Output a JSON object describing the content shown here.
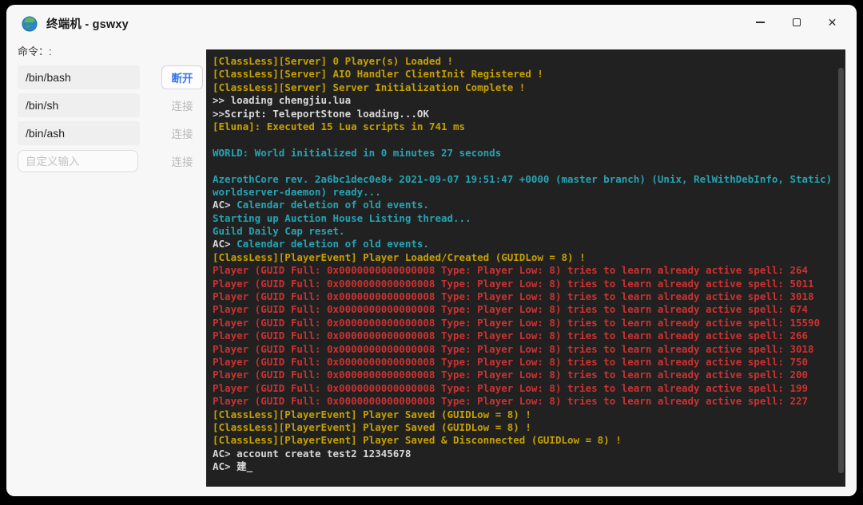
{
  "window": {
    "title": "终端机 - gswxy",
    "controls": {
      "minimize": "minimize",
      "maximize": "maximize",
      "close": "close"
    }
  },
  "sidebar": {
    "label": "命令：:",
    "rows": [
      {
        "command": "/bin/bash",
        "action": "断开",
        "state": "connected"
      },
      {
        "command": "/bin/sh",
        "action": "连接",
        "state": "idle"
      },
      {
        "command": "/bin/ash",
        "action": "连接",
        "state": "idle"
      },
      {
        "placeholder": "自定义输入",
        "action": "连接",
        "state": "idle"
      }
    ]
  },
  "terminal": {
    "background": "#212121",
    "palette": {
      "y": "#c5a000",
      "c": "#25a3b4",
      "w": "#d8d8d8",
      "r": "#cd3131"
    },
    "scrollbar_color": "#474747",
    "lines": [
      [
        {
          "t": "[ClassLess][Server] 0 Player(s) Loaded !",
          "c": "y"
        }
      ],
      [
        {
          "t": "[ClassLess][Server] AIO Handler ClientInit Registered !",
          "c": "y"
        }
      ],
      [
        {
          "t": "[ClassLess][Server] Server Initialization Complete !",
          "c": "y"
        }
      ],
      [
        {
          "t": ">> loading chengjiu.lua",
          "c": "w"
        }
      ],
      [
        {
          "t": ">>Script: TeleportStone loading...OK",
          "c": "w"
        }
      ],
      [
        {
          "t": "[Eluna]: Executed 15 Lua scripts in 741 ms",
          "c": "y"
        }
      ],
      [],
      [
        {
          "t": "WORLD: World initialized in 0 minutes 27 seconds",
          "c": "c"
        }
      ],
      [],
      [
        {
          "t": "AzerothCore rev. 2a6bc1dec0e8+ 2021-09-07 19:51:47 +0000 (master branch) (Unix, RelWithDebInfo, Static) (",
          "c": "c"
        }
      ],
      [
        {
          "t": "worldserver-daemon) ready...",
          "c": "c"
        }
      ],
      [
        {
          "t": "AC> ",
          "c": "w",
          "b": true
        },
        {
          "t": "Calendar deletion of old events.",
          "c": "c"
        }
      ],
      [
        {
          "t": "Starting up Auction House Listing thread...",
          "c": "c"
        }
      ],
      [
        {
          "t": "Guild Daily Cap reset.",
          "c": "c"
        }
      ],
      [
        {
          "t": "AC> ",
          "c": "w",
          "b": true
        },
        {
          "t": "Calendar deletion of old events.",
          "c": "c"
        }
      ],
      [
        {
          "t": "[ClassLess][PlayerEvent] Player Loaded/Created (GUIDLow = 8) !",
          "c": "y"
        }
      ],
      [
        {
          "t": "Player (GUID Full: 0x0000000000000008 Type: Player Low: 8) tries to learn already active spell: 264",
          "c": "r"
        }
      ],
      [
        {
          "t": "Player (GUID Full: 0x0000000000000008 Type: Player Low: 8) tries to learn already active spell: 5011",
          "c": "r"
        }
      ],
      [
        {
          "t": "Player (GUID Full: 0x0000000000000008 Type: Player Low: 8) tries to learn already active spell: 3018",
          "c": "r"
        }
      ],
      [
        {
          "t": "Player (GUID Full: 0x0000000000000008 Type: Player Low: 8) tries to learn already active spell: 674",
          "c": "r"
        }
      ],
      [
        {
          "t": "Player (GUID Full: 0x0000000000000008 Type: Player Low: 8) tries to learn already active spell: 15590",
          "c": "r"
        }
      ],
      [
        {
          "t": "Player (GUID Full: 0x0000000000000008 Type: Player Low: 8) tries to learn already active spell: 266",
          "c": "r"
        }
      ],
      [
        {
          "t": "Player (GUID Full: 0x0000000000000008 Type: Player Low: 8) tries to learn already active spell: 3018",
          "c": "r"
        }
      ],
      [
        {
          "t": "Player (GUID Full: 0x0000000000000008 Type: Player Low: 8) tries to learn already active spell: 750",
          "c": "r"
        }
      ],
      [
        {
          "t": "Player (GUID Full: 0x0000000000000008 Type: Player Low: 8) tries to learn already active spell: 200",
          "c": "r"
        }
      ],
      [
        {
          "t": "Player (GUID Full: 0x0000000000000008 Type: Player Low: 8) tries to learn already active spell: 199",
          "c": "r"
        }
      ],
      [
        {
          "t": "Player (GUID Full: 0x0000000000000008 Type: Player Low: 8) tries to learn already active spell: 227",
          "c": "r"
        }
      ],
      [
        {
          "t": "[ClassLess][PlayerEvent] Player Saved (GUIDLow = 8) !",
          "c": "y"
        }
      ],
      [
        {
          "t": "[ClassLess][PlayerEvent] Player Saved (GUIDLow = 8) !",
          "c": "y"
        }
      ],
      [
        {
          "t": "[ClassLess][PlayerEvent] Player Saved & Disconnected (GUIDLow = 8) !",
          "c": "y"
        }
      ],
      [
        {
          "t": "AC> ",
          "c": "w",
          "b": true
        },
        {
          "t": "account create test2 12345678",
          "c": "w"
        }
      ],
      [
        {
          "t": "AC> ",
          "c": "w",
          "b": true
        },
        {
          "t": "建_",
          "c": "w"
        }
      ]
    ]
  }
}
